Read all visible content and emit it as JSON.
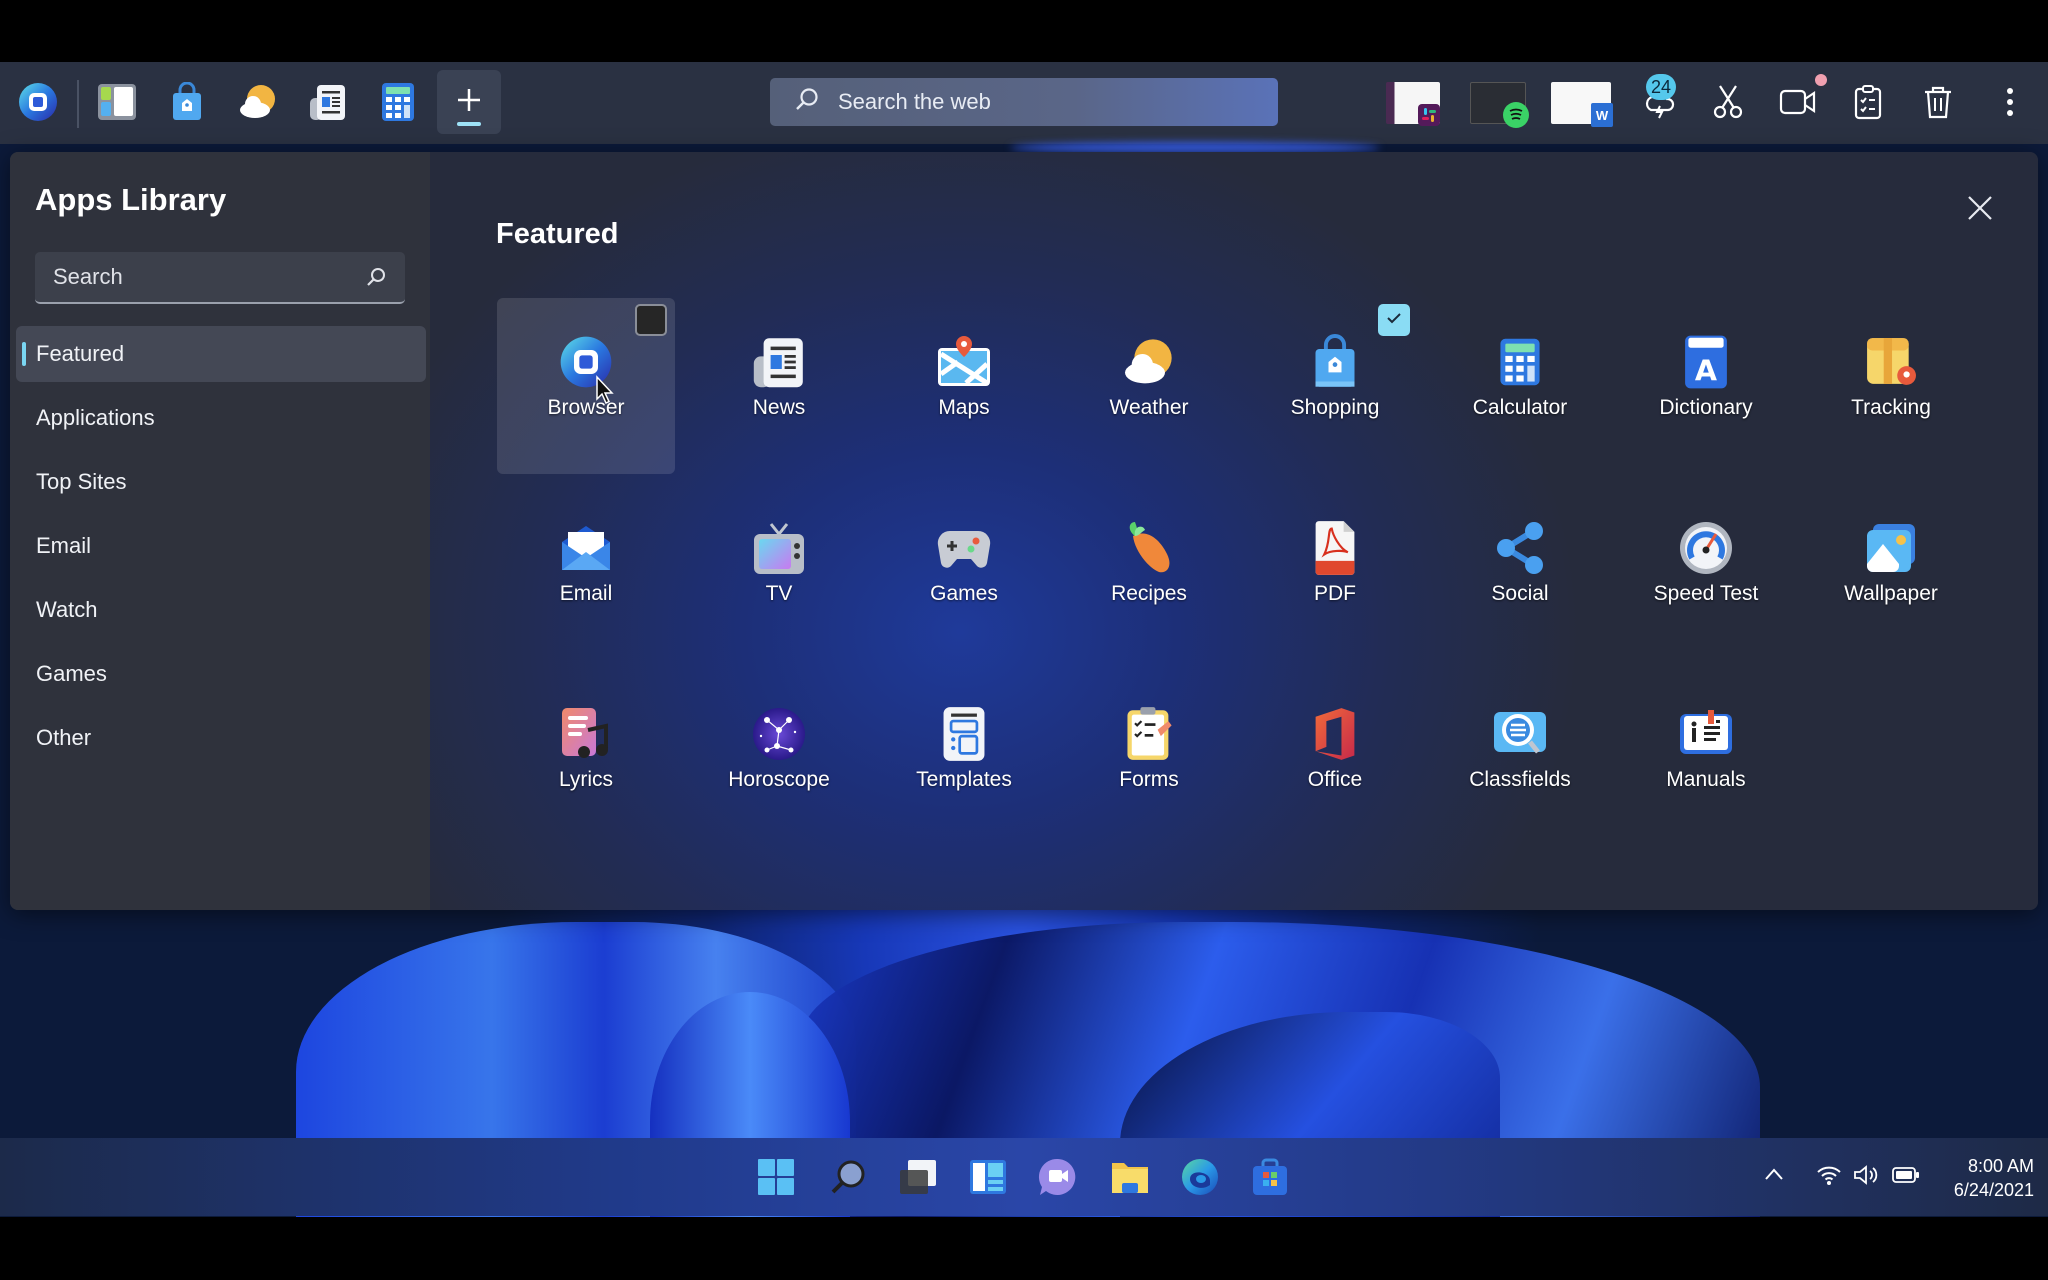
{
  "topbar": {
    "pinned_apps": [
      {
        "name": "browser",
        "icon": "browser-icon"
      },
      {
        "name": "widgets",
        "icon": "widgets-icon"
      },
      {
        "name": "shopping",
        "icon": "shopping-bag-icon"
      },
      {
        "name": "weather",
        "icon": "weather-icon"
      },
      {
        "name": "news",
        "icon": "news-icon"
      },
      {
        "name": "calculator",
        "icon": "calculator-icon"
      }
    ],
    "add_button_label": "+",
    "search_placeholder": "Search the web",
    "recent_windows": [
      {
        "app": "Slack",
        "icon": "slack-icon"
      },
      {
        "app": "Spotify",
        "icon": "spotify-icon"
      },
      {
        "app": "Word",
        "icon": "word-icon"
      }
    ],
    "weather_alert_count": "24",
    "tools": [
      "snip-icon",
      "video-icon",
      "clipboard-icon",
      "trash-icon",
      "more-icon"
    ]
  },
  "panel": {
    "title": "Apps Library",
    "search_placeholder": "Search",
    "nav": [
      {
        "label": "Featured",
        "active": true
      },
      {
        "label": "Applications"
      },
      {
        "label": "Top Sites"
      },
      {
        "label": "Email"
      },
      {
        "label": "Watch"
      },
      {
        "label": "Games"
      },
      {
        "label": "Other"
      }
    ],
    "section_title": "Featured",
    "apps": [
      {
        "label": "Browser",
        "icon": "browser-icon",
        "checked": false,
        "hover": true
      },
      {
        "label": "News",
        "icon": "news-icon"
      },
      {
        "label": "Maps",
        "icon": "maps-icon"
      },
      {
        "label": "Weather",
        "icon": "weather-icon"
      },
      {
        "label": "Shopping",
        "icon": "shopping-bag-icon",
        "checked": true
      },
      {
        "label": "Calculator",
        "icon": "calculator-icon"
      },
      {
        "label": "Dictionary",
        "icon": "dictionary-icon"
      },
      {
        "label": "Tracking",
        "icon": "package-tracking-icon"
      },
      {
        "label": "Email",
        "icon": "email-icon"
      },
      {
        "label": "TV",
        "icon": "tv-icon"
      },
      {
        "label": "Games",
        "icon": "gamepad-icon"
      },
      {
        "label": "Recipes",
        "icon": "carrot-icon"
      },
      {
        "label": "PDF",
        "icon": "pdf-icon"
      },
      {
        "label": "Social",
        "icon": "share-icon"
      },
      {
        "label": "Speed Test",
        "icon": "speedometer-icon"
      },
      {
        "label": "Wallpaper",
        "icon": "wallpaper-icon"
      },
      {
        "label": "Lyrics",
        "icon": "lyrics-icon"
      },
      {
        "label": "Horoscope",
        "icon": "horoscope-icon"
      },
      {
        "label": "Templates",
        "icon": "templates-icon"
      },
      {
        "label": "Forms",
        "icon": "forms-icon"
      },
      {
        "label": "Office",
        "icon": "office-icon"
      },
      {
        "label": "Classfields",
        "icon": "classifieds-icon"
      },
      {
        "label": "Manuals",
        "icon": "manuals-icon"
      }
    ]
  },
  "taskbar": {
    "apps": [
      "start-icon",
      "search-icon",
      "task-view-icon",
      "widgets-icon",
      "chat-icon",
      "file-explorer-icon",
      "edge-icon",
      "store-icon"
    ],
    "clock_time": "8:00 AM",
    "clock_date": "6/24/2021"
  },
  "colors": {
    "accent": "#7ad6f2",
    "topbar_bg": "#2a3142",
    "sidebar_bg": "#2f323c"
  }
}
